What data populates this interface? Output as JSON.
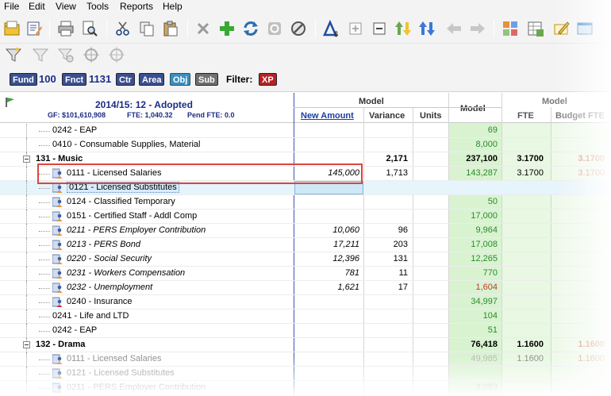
{
  "menu": [
    "File",
    "Edit",
    "View",
    "Tools",
    "Reports",
    "Help"
  ],
  "toolbar_icons": [
    "open-folder-icon",
    "edit-document-icon",
    "print-icon",
    "print-preview-icon",
    "cut-icon",
    "copy-icon",
    "paste-icon",
    "delete-icon",
    "add-icon",
    "refresh-icon",
    "reload-icon",
    "cancel-icon",
    "triangle-dollar-icon",
    "expand-icon",
    "collapse-icon",
    "move-up-down-icon",
    "move-down-up-icon",
    "back-arrow-icon",
    "forward-arrow-icon",
    "calculator-icon",
    "spreadsheet-icon",
    "note-icon",
    "window-icon"
  ],
  "toolbar2_icons": [
    "filter-icon",
    "filter-clear-icon",
    "filter-remove-icon",
    "target-icon",
    "target-clear-icon"
  ],
  "filter": {
    "fund_label": "Fund",
    "fund_value": "100",
    "fnct_label": "Fnct",
    "fnct_value": "1131",
    "ctr_label": "Ctr",
    "area_label": "Area",
    "obj_label": "Obj",
    "sub_label": "Sub",
    "filter_label": "Filter:",
    "filter_value": "XP"
  },
  "grid": {
    "title": "2014/15: 12 - Adopted",
    "gf": "GF: $101,610,908",
    "fte": "FTE: 1,040.32",
    "pend": "Pend FTE: 0.0",
    "group1": "Model",
    "col_new_amount": "New Amount",
    "col_variance": "Variance",
    "col_units": "Units",
    "col_model": "Model",
    "group2": "Model",
    "col_fte": "FTE",
    "col_budget_fte": "Budget FTE"
  },
  "rows": [
    {
      "name": "0242 - EAP",
      "indent": 2,
      "model": "69"
    },
    {
      "name": "0410 - Consumable Supplies, Material",
      "indent": 2,
      "model": "8,000"
    },
    {
      "name": "131 - Music",
      "indent": 1,
      "bold": true,
      "variance": "2,171",
      "model": "237,100",
      "fte": "3.1700",
      "bfte": "3.1700",
      "expander": true
    },
    {
      "name": "0111 - Licensed Salaries",
      "indent": 2,
      "icon": "person-icon",
      "new_amount": "145,000",
      "variance": "1,713",
      "model": "143,287",
      "fte": "3.1700",
      "bfte": "3.1700"
    },
    {
      "name": "0121 - Licensed Substitutes",
      "indent": 2,
      "icon": "person-icon",
      "selected": true
    },
    {
      "name": "0124 - Classified Temporary",
      "indent": 2,
      "icon": "person-icon",
      "model": "50"
    },
    {
      "name": "0151 - Certified Staff - Addl Comp",
      "indent": 2,
      "icon": "person-icon",
      "model": "17,000"
    },
    {
      "name": "0211 - PERS Employer Contribution",
      "indent": 2,
      "icon": "person-icon",
      "italic": true,
      "new_amount": "10,060",
      "variance": "96",
      "model": "9,964"
    },
    {
      "name": "0213 - PERS Bond",
      "indent": 2,
      "icon": "person-icon",
      "italic": true,
      "new_amount": "17,211",
      "variance": "203",
      "model": "17,008"
    },
    {
      "name": "0220 - Social Security",
      "indent": 2,
      "icon": "person-icon",
      "italic": true,
      "new_amount": "12,396",
      "variance": "131",
      "model": "12,265"
    },
    {
      "name": "0231 - Workers Compensation",
      "indent": 2,
      "icon": "person-icon",
      "italic": true,
      "new_amount": "781",
      "variance": "11",
      "model": "770"
    },
    {
      "name": "0232 - Unemployment",
      "indent": 2,
      "icon": "person-icon",
      "italic": true,
      "new_amount": "1,621",
      "variance": "17",
      "model": "1,604",
      "model_red": true
    },
    {
      "name": "0240 - Insurance",
      "indent": 2,
      "icon": "person-red-icon",
      "model": "34,997"
    },
    {
      "name": "0241 - Life and LTD",
      "indent": 2,
      "model": "104"
    },
    {
      "name": "0242 - EAP",
      "indent": 2,
      "model": "51"
    },
    {
      "name": "132 - Drama",
      "indent": 1,
      "bold": true,
      "model": "76,418",
      "fte": "1.1600",
      "bfte": "1.1600",
      "expander": true
    },
    {
      "name": "0111 - Licensed Salaries",
      "indent": 2,
      "icon": "person-icon",
      "gray": true,
      "model": "49,985",
      "fte": "1.1600",
      "bfte": "1.1600"
    },
    {
      "name": "0121 - Licensed Substitutes",
      "indent": 2,
      "icon": "person-icon",
      "gray": true
    },
    {
      "name": "0211 - PERS Employer Contribution",
      "indent": 2,
      "icon": "person-icon",
      "gray": true,
      "model": "3,083"
    }
  ]
}
